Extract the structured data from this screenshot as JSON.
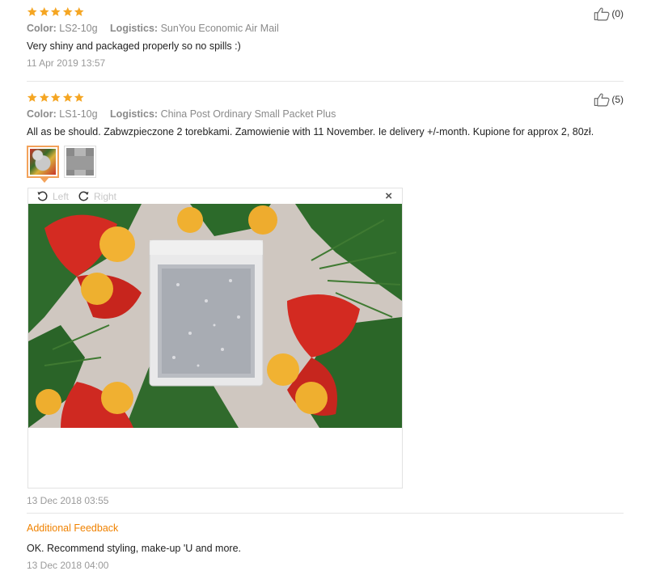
{
  "colors": {
    "star": "#f5a623",
    "accent_orange": "#f08200",
    "divider": "#e6e6e6"
  },
  "reviews": [
    {
      "rating": 5,
      "color_label": "Color:",
      "color_value": "LS2-10g",
      "logistics_label": "Logistics:",
      "logistics_value": "SunYou Economic Air Mail",
      "text": "Very shiny and packaged properly so no spills :)",
      "date": "11 Apr 2019 13:57",
      "helpful_count": "(0)",
      "helpful_icon": "thumbs-up-icon"
    },
    {
      "rating": 5,
      "color_label": "Color:",
      "color_value": "LS1-10g",
      "logistics_label": "Logistics:",
      "logistics_value": "China Post Ordinary Small Packet Plus",
      "text": "All as be should. Zabwzpieczone 2 torebkami. Zamowienie with 11 November. Ie delivery +/-month. Kupione for approx 2, 80zł.",
      "date": "13 Dec 2018 03:55",
      "helpful_count": "(5)",
      "helpful_icon": "thumbs-up-icon",
      "photos": [
        "photo-1",
        "photo-2"
      ],
      "viewer": {
        "rotate_left_label": "Left",
        "rotate_right_label": "Right",
        "close_label": "×"
      },
      "additional_feedback": {
        "title": "Additional Feedback",
        "text": "OK. Recommend styling, make-up 'U and more.",
        "date": "13 Dec 2018 04:00"
      }
    }
  ]
}
